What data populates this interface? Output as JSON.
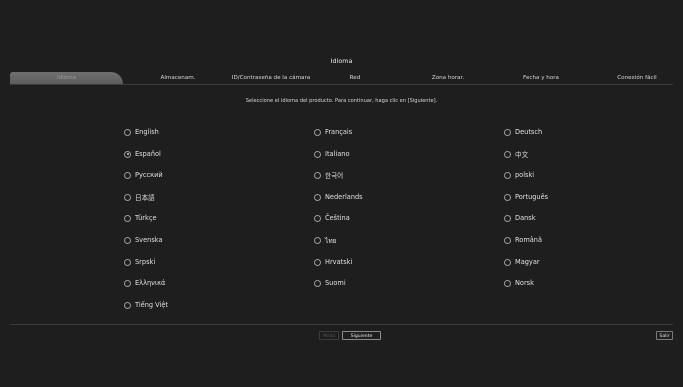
{
  "title": "Idioma",
  "tabs": [
    "Idioma",
    "Almacenam.",
    "ID/Contraseña de la cámara",
    "Red",
    "Zona horar.",
    "Fecha y hora",
    "Conexión fácil"
  ],
  "active_tab": 0,
  "instruction": "Seleccione el idioma del producto. Para continuar, haga clic en [Siguiente].",
  "languages": [
    [
      "English",
      "Français",
      "Deutsch"
    ],
    [
      "Español",
      "Italiano",
      "中文"
    ],
    [
      "Русский",
      "한국어",
      "polski"
    ],
    [
      "日本語",
      "Nederlands",
      "Português"
    ],
    [
      "Türkçe",
      "Čeština",
      "Dansk"
    ],
    [
      "Svenska",
      "ไทย",
      "Română"
    ],
    [
      "Srpski",
      "Hrvatski",
      "Magyar"
    ],
    [
      "Ελληνικά",
      "Suomi",
      "Norsk"
    ],
    [
      "Tiếng Việt"
    ]
  ],
  "selected_language": "Español",
  "buttons": {
    "prev": "Atrás",
    "next": "Siguiente",
    "exit": "Salir"
  }
}
